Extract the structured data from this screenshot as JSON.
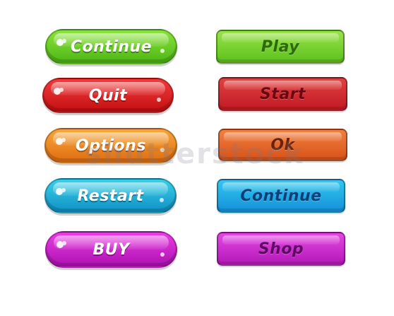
{
  "left_buttons": [
    {
      "label": "Continue",
      "color": "#5ec41f"
    },
    {
      "label": "Quit",
      "color": "#d81a1e"
    },
    {
      "label": "Options",
      "color": "#ec8a25"
    },
    {
      "label": "Restart",
      "color": "#1fa9d4"
    },
    {
      "label": "BUY",
      "color": "#c21fc6"
    }
  ],
  "right_buttons": [
    {
      "label": "Play",
      "color": "#6fcb2a"
    },
    {
      "label": "Start",
      "color": "#cc2530"
    },
    {
      "label": "Ok",
      "color": "#e0622a"
    },
    {
      "label": "Continue",
      "color": "#1ea8e2"
    },
    {
      "label": "Shop",
      "color": "#c42bc8"
    }
  ],
  "watermark": {
    "text": "shutterstock"
  }
}
